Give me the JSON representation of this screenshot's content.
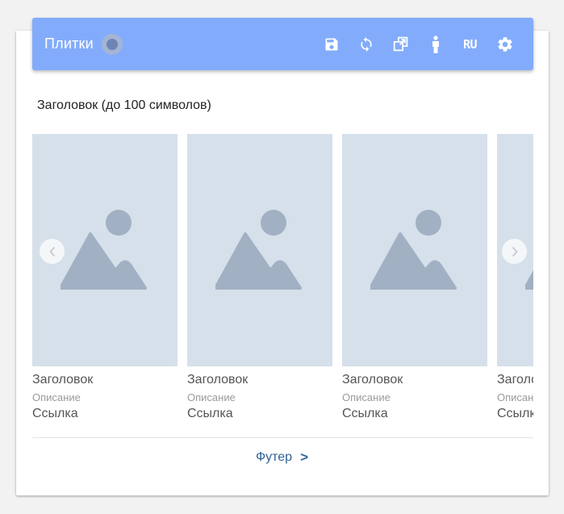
{
  "toolbar": {
    "title": "Плитки",
    "lang": "RU",
    "actions": [
      {
        "icon": "save-icon"
      },
      {
        "icon": "refresh-icon"
      },
      {
        "icon": "open-external-icon"
      },
      {
        "icon": "person-icon"
      },
      {
        "icon": "language-icon"
      },
      {
        "icon": "gear-icon"
      }
    ],
    "color": "#82acfb"
  },
  "section": {
    "heading": "Заголовок (до 100 символов)"
  },
  "tiles": [
    {
      "title": "Заголовок",
      "description": "Описание",
      "link": "Ссылка",
      "image": "image-placeholder-icon"
    },
    {
      "title": "Заголовок",
      "description": "Описание",
      "link": "Ссылка",
      "image": "image-placeholder-icon"
    },
    {
      "title": "Заголовок",
      "description": "Описание",
      "link": "Ссылка",
      "image": "image-placeholder-icon"
    },
    {
      "title": "Заголовок",
      "description": "Описание",
      "link": "Ссылка",
      "image": "image-placeholder-icon"
    }
  ],
  "footer": {
    "link": "Футер",
    "arrow": ">"
  },
  "colors": {
    "placeholder_bg": "#d6e0ea",
    "placeholder_fg": "#a1b0c3",
    "link": "#2f6499"
  }
}
